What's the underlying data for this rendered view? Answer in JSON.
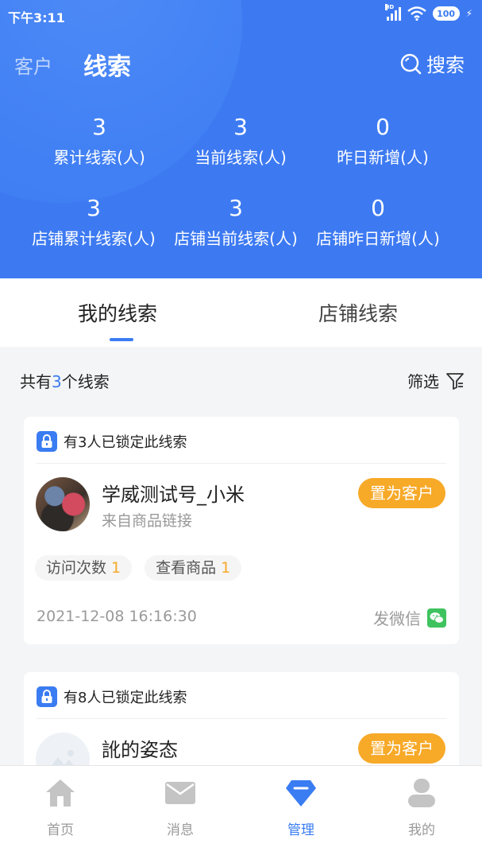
{
  "status_bar": {
    "time": "下午3:11",
    "battery": "100",
    "network_badge": "HD"
  },
  "top_nav": {
    "tab_customer": "客户",
    "tab_leads": "线索",
    "search_label": "搜索"
  },
  "stats": [
    {
      "value": "3",
      "label": "累计线索(人)"
    },
    {
      "value": "3",
      "label": "当前线索(人)"
    },
    {
      "value": "0",
      "label": "昨日新增(人)"
    },
    {
      "value": "3",
      "label": "店铺累计线索(人)"
    },
    {
      "value": "3",
      "label": "店铺当前线索(人)"
    },
    {
      "value": "0",
      "label": "店铺昨日新增(人)"
    }
  ],
  "tabs": {
    "mine": "我的线索",
    "store": "店铺线索"
  },
  "summary": {
    "prefix": "共有",
    "count": "3",
    "suffix": "个线索",
    "filter_label": "筛选"
  },
  "leads": [
    {
      "lock_text": "有3人已锁定此线索",
      "name": "学威测试号_小米",
      "source": "来自商品链接",
      "convert_label": "置为客户",
      "visits_label": "访问次数",
      "visits_value": "1",
      "views_label": "查看商品",
      "views_value": "1",
      "timestamp": "2021-12-08 16:16:30",
      "wechat_label": "发微信"
    },
    {
      "lock_text": "有8人已锁定此线索",
      "name": "訛的姿态",
      "convert_label": "置为客户"
    }
  ],
  "bottom_nav": [
    {
      "label": "首页",
      "icon": "home-icon"
    },
    {
      "label": "消息",
      "icon": "mail-icon"
    },
    {
      "label": "管理",
      "icon": "diamond-icon",
      "active": true
    },
    {
      "label": "我的",
      "icon": "user-icon"
    }
  ],
  "colors": {
    "primary": "#3d7af2",
    "accent": "#f7a928",
    "wechat": "#3fc35f"
  }
}
